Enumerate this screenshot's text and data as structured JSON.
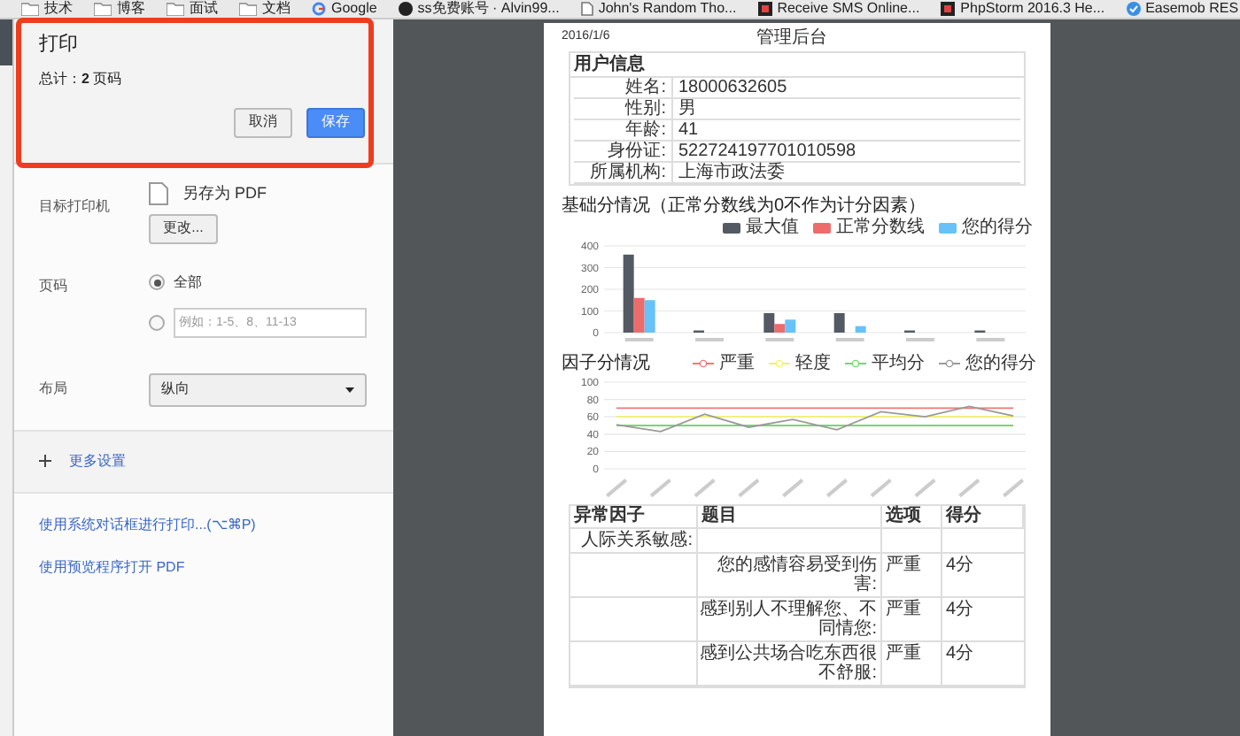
{
  "bookmarks": [
    {
      "label": "技术",
      "kind": "folder"
    },
    {
      "label": "博客",
      "kind": "folder"
    },
    {
      "label": "面试",
      "kind": "folder"
    },
    {
      "label": "文档",
      "kind": "folder"
    },
    {
      "label": "Google",
      "kind": "google"
    },
    {
      "label": "ss免费账号 · Alvin99...",
      "kind": "github"
    },
    {
      "label": "John's Random Tho...",
      "kind": "page"
    },
    {
      "label": "Receive SMS Online...",
      "kind": "site"
    },
    {
      "label": "PhpStorm 2016.3 He...",
      "kind": "site"
    },
    {
      "label": "Easemob RES",
      "kind": "check"
    }
  ],
  "print": {
    "title": "打印",
    "total": "总计：**2** 页码",
    "cancel": "取消",
    "save": "保存",
    "destination": {
      "label": "目标打印机",
      "value": "另存为 PDF",
      "change": "更改..."
    },
    "pages": {
      "label": "页码",
      "options": [
        {
          "kind": "all",
          "label": "全部",
          "selected": true
        },
        {
          "kind": "range",
          "placeholder": "例如：1-5、8、11-13",
          "selected": false
        }
      ]
    },
    "layout": {
      "label": "布局",
      "value": "纵向"
    },
    "more": "更多设置",
    "links": [
      "使用系统对话框进行打印...(⌥⌘P)",
      "使用预览程序打开 PDF"
    ]
  },
  "preview": {
    "date": "2016/1/6",
    "header": "管理后台",
    "user_info": {
      "title": "用户信息",
      "rows": [
        {
          "label": "姓名:",
          "value": "18000632605"
        },
        {
          "label": "性别:",
          "value": "男"
        },
        {
          "label": "年龄:",
          "value": "41"
        },
        {
          "label": "身份证:",
          "value": "522724197701010598"
        },
        {
          "label": "所属机构:",
          "value": "上海市政法委"
        }
      ]
    },
    "bar_section": {
      "chart_data": {
        "type": "bar",
        "title": "基础分情况（正常分数线为0不作为计分因素）",
        "grid": true,
        "ylim": [
          0,
          400
        ],
        "yticks": [
          0,
          100,
          200,
          300,
          400
        ],
        "series": [
          {
            "name": "最大值",
            "color": "#535a63",
            "values": [
              360,
              10,
              90,
              90,
              10,
              10
            ]
          },
          {
            "name": "正常分数线",
            "color": "#ee6b6b",
            "values": [
              160,
              0,
              40,
              0,
              0,
              0
            ]
          },
          {
            "name": "您的得分",
            "color": "#66c2f9",
            "values": [
              150,
              null,
              60,
              30,
              null,
              null
            ]
          }
        ]
      }
    },
    "line_section": {
      "chart_data": {
        "type": "line",
        "title": "因子分情况",
        "grid": true,
        "ylim": [
          0,
          100
        ],
        "yticks": [
          0,
          20,
          40,
          60,
          80,
          100
        ],
        "series": [
          {
            "name": "严重",
            "color": "#f07777",
            "values": [
              70,
              70,
              70,
              70,
              70,
              70,
              70,
              70,
              70,
              70
            ]
          },
          {
            "name": "轻度",
            "color": "#f3ef6b",
            "values": [
              60,
              60,
              60,
              60,
              60,
              60,
              60,
              60,
              60,
              60
            ]
          },
          {
            "name": "平均分",
            "color": "#74d874",
            "values": [
              50,
              50,
              50,
              50,
              50,
              50,
              50,
              50,
              50,
              50
            ]
          },
          {
            "name": "您的得分",
            "color": "#9a9a9a",
            "values": [
              51,
              43,
              63,
              48,
              57,
              45,
              66,
              60,
              72,
              61
            ]
          }
        ]
      }
    },
    "factor_table": {
      "columns": [
        "异常因子",
        "题目",
        "选项",
        "得分"
      ],
      "rows": [
        {
          "factor": "人际关系敏感:",
          "question": "",
          "option": "",
          "score": ""
        },
        {
          "factor": "",
          "question": "您的感情容易受到伤害:",
          "option": "严重",
          "score": "4分"
        },
        {
          "factor": "",
          "question": "感到别人不理解您、不同情您:",
          "option": "严重",
          "score": "4分"
        },
        {
          "factor": "",
          "question": "感到公共场合吃东西很不舒服:",
          "option": "严重",
          "score": "4分"
        }
      ]
    }
  }
}
